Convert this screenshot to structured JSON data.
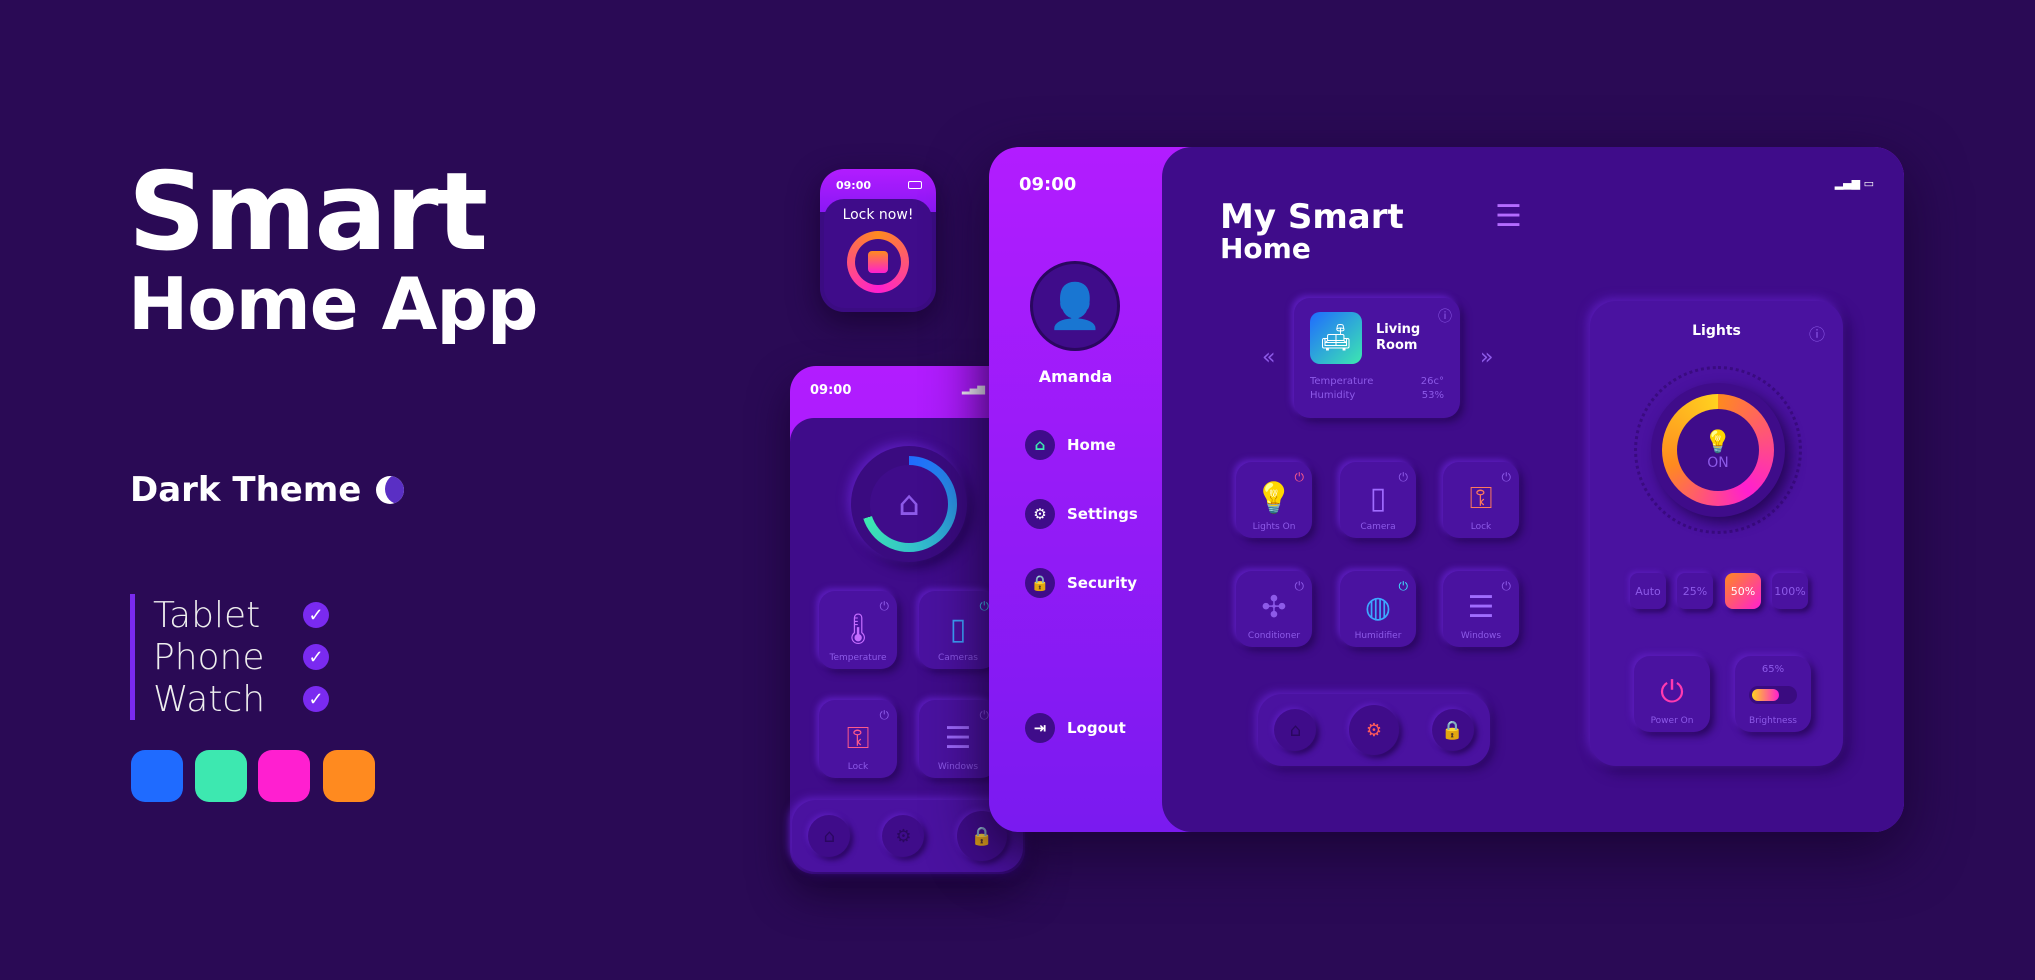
{
  "promo": {
    "title_line1": "Smart",
    "title_line2": "Home App",
    "theme": "Dark Theme",
    "devices": [
      {
        "label": "Tablet"
      },
      {
        "label": "Phone"
      },
      {
        "label": "Watch"
      }
    ],
    "swatches": [
      "#1f6bff",
      "#3de8b0",
      "#ff1fd0",
      "#ff8a1f"
    ]
  },
  "watch": {
    "time": "09:00",
    "prompt": "Lock now!"
  },
  "phone": {
    "time": "09:00",
    "tiles": [
      {
        "label": "Temperature",
        "icon": "thermometer-icon"
      },
      {
        "label": "Cameras",
        "icon": "camera-icon"
      },
      {
        "label": "Lock",
        "icon": "door-lock-icon"
      },
      {
        "label": "Windows",
        "icon": "blinds-icon"
      }
    ]
  },
  "tablet": {
    "time": "09:00",
    "user": "Amanda",
    "title_line1": "My Smart",
    "title_line2": "Home",
    "menu": [
      {
        "label": "Home",
        "icon": "home-icon"
      },
      {
        "label": "Settings",
        "icon": "gear-icon"
      },
      {
        "label": "Security",
        "icon": "lock-icon"
      }
    ],
    "logout": "Logout",
    "room": {
      "name_line1": "Living",
      "name_line2": "Room",
      "temp_label": "Temperature",
      "temp_value": "26c°",
      "hum_label": "Humidity",
      "hum_value": "53%"
    },
    "tiles": [
      {
        "label": "Lights On",
        "icon": "bulb-icon"
      },
      {
        "label": "Camera",
        "icon": "camera-icon"
      },
      {
        "label": "Lock",
        "icon": "door-lock-icon"
      },
      {
        "label": "Conditioner",
        "icon": "fan-icon"
      },
      {
        "label": "Humidifier",
        "icon": "humidifier-icon"
      },
      {
        "label": "Windows",
        "icon": "blinds-icon"
      }
    ],
    "lights": {
      "title": "Lights",
      "state": "ON",
      "modes": [
        "Auto",
        "25%",
        "50%",
        "100%"
      ],
      "selected_mode": "50%",
      "power_label": "Power On",
      "brightness_label": "Brightness",
      "brightness_value": "65%",
      "brightness": 65
    }
  },
  "colors": {
    "background": "#2a0a55",
    "panel": "#3f0c8a",
    "accent": "#b21cff"
  }
}
